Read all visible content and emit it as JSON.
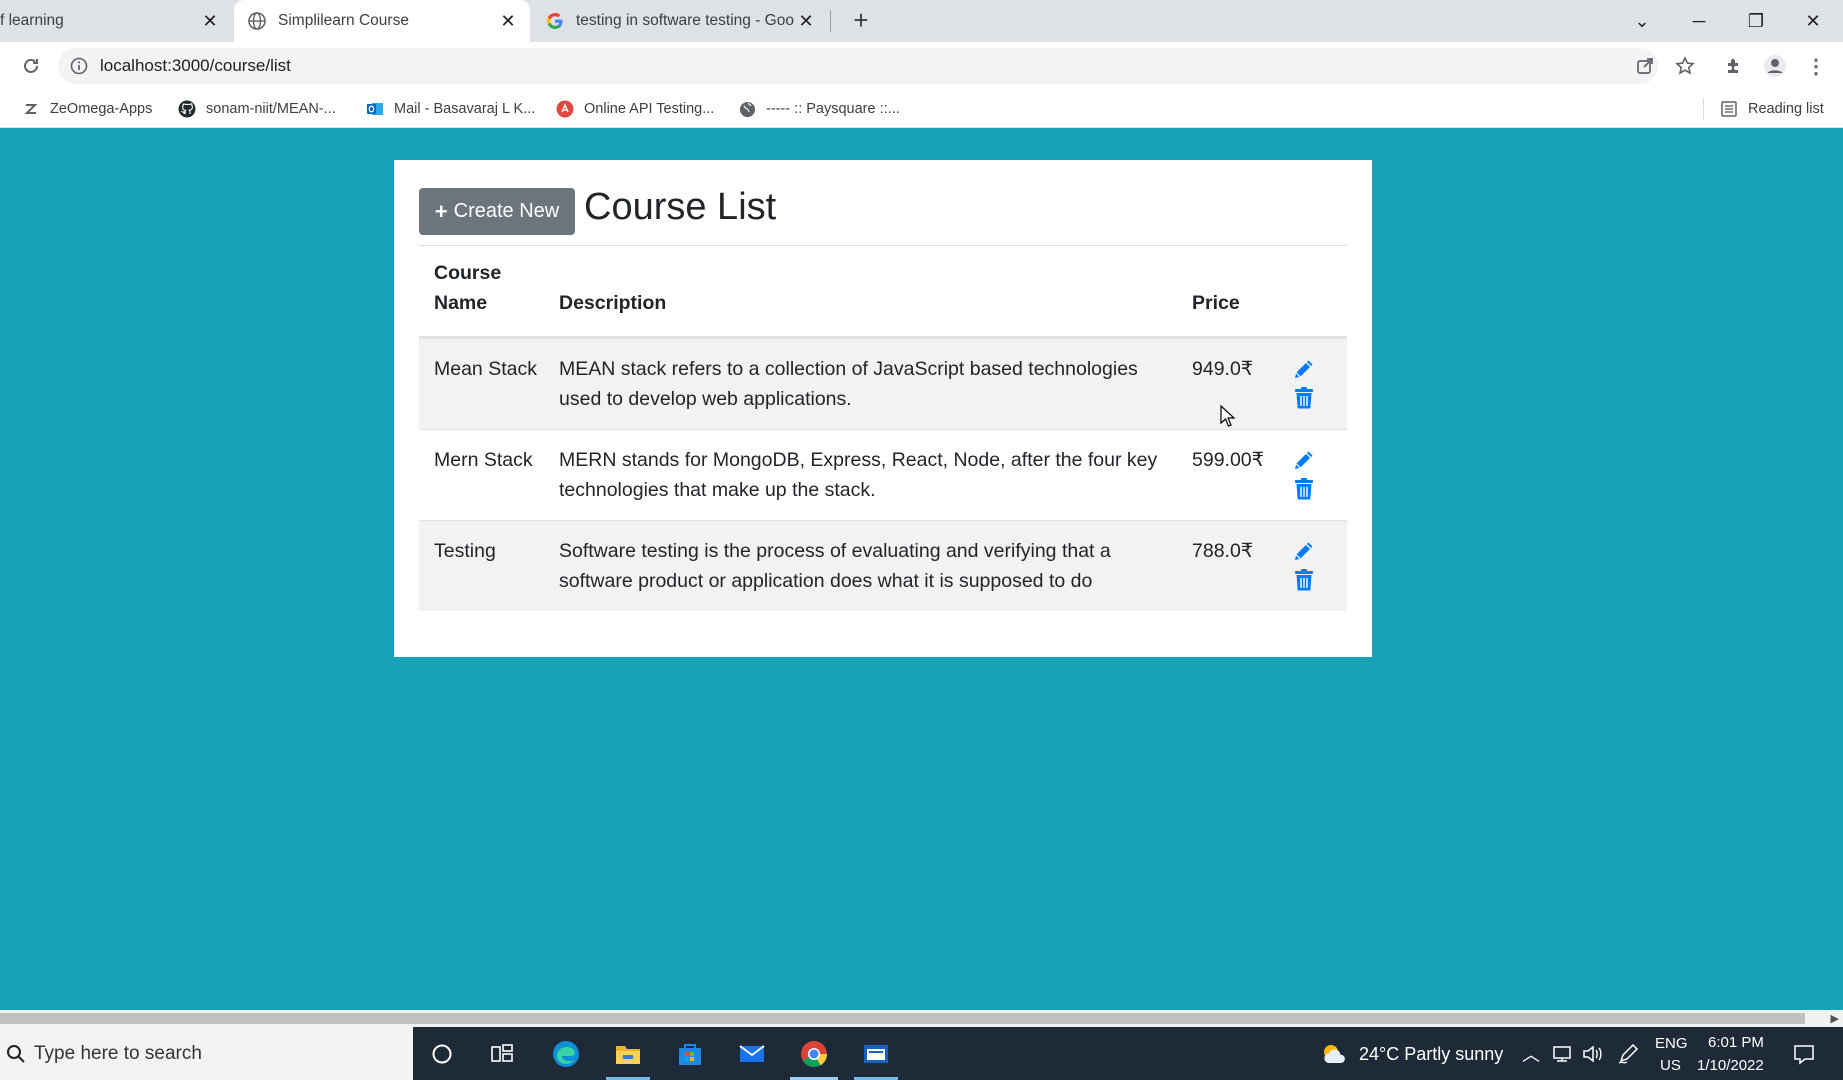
{
  "browser": {
    "tabs": [
      {
        "title": "f learning",
        "active": false
      },
      {
        "title": "Simplilearn Course",
        "active": true
      },
      {
        "title": "testing in software testing - Goo",
        "active": false
      }
    ],
    "url": "localhost:3000/course/list",
    "bookmarks": [
      {
        "label": "ZeOmega-Apps",
        "icon": "zeomega-icon"
      },
      {
        "label": "sonam-niit/MEAN-...",
        "icon": "github-icon"
      },
      {
        "label": "Mail - Basavaraj L K...",
        "icon": "outlook-icon"
      },
      {
        "label": "Online API Testing...",
        "icon": "api-testing-icon"
      },
      {
        "label": "----- :: Paysquare ::...",
        "icon": "globe-icon"
      }
    ],
    "reading_list_label": "Reading list"
  },
  "page": {
    "create_button_label": "Create New",
    "title": "Course List",
    "columns": {
      "name": "Course Name",
      "description": "Description",
      "price": "Price"
    },
    "rows": [
      {
        "name": "Mean Stack",
        "description": "MEAN stack refers to a collection of JavaScript based technologies used to develop web applications.",
        "price": "949.0₹"
      },
      {
        "name": "Mern Stack",
        "description": "MERN stands for MongoDB, Express, React, Node, after the four key technologies that make up the stack.",
        "price": "599.00₹"
      },
      {
        "name": "Testing",
        "description": "Software testing is the process of evaluating and verifying that a software product or application does what it is supposed to do",
        "price": "788.0₹"
      }
    ]
  },
  "taskbar": {
    "search_placeholder": "Type here to search",
    "weather": "24°C  Partly sunny",
    "lang_top": "ENG",
    "lang_bottom": "US",
    "time": "6:01 PM",
    "date": "1/10/2022"
  },
  "colors": {
    "page_background": "#17a2b8",
    "create_button": "#6c757d",
    "action_icon": "#007bff"
  }
}
